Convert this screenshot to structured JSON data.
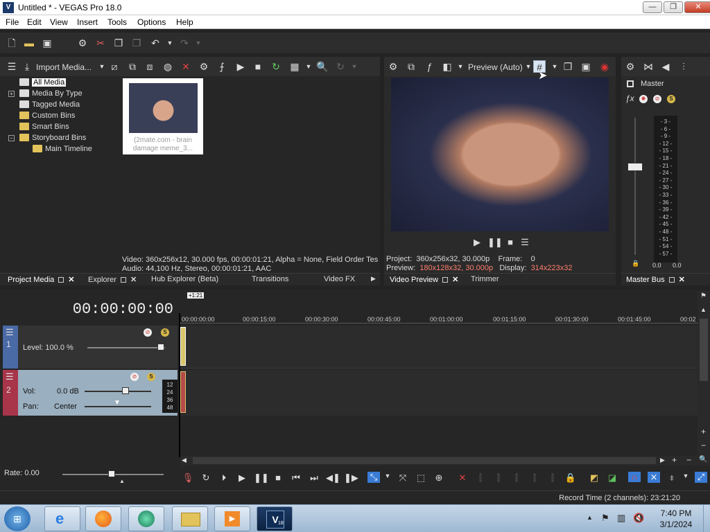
{
  "window": {
    "title": "Untitled * - VEGAS Pro 18.0",
    "app_icon_text": "V",
    "controls": {
      "minimize": "—",
      "maximize": "❐",
      "close": "✕"
    }
  },
  "menu": [
    "File",
    "Edit",
    "View",
    "Insert",
    "Tools",
    "Options",
    "Help"
  ],
  "project_media": {
    "import_label": "Import Media...",
    "tree": [
      {
        "label": "All Media",
        "selected": true
      },
      {
        "label": "Media By Type",
        "expandable": true
      },
      {
        "label": "Tagged Media"
      },
      {
        "label": "Custom Bins"
      },
      {
        "label": "Smart Bins"
      },
      {
        "label": "Storyboard Bins",
        "expandable": true
      },
      {
        "label": "Main Timeline"
      }
    ],
    "thumbnail_caption_line1": "(2mate.com - brain",
    "thumbnail_caption_line2": "damage meme_3...",
    "info_video": "Video: 360x256x12, 30.000 fps, 00:00:01:21, Alpha = None, Field Order Tes",
    "info_audio": "Audio: 44,100 Hz, Stereo, 00:00:01:21, AAC"
  },
  "left_tabs": [
    "Project Media",
    "Explorer",
    "Hub Explorer (Beta)",
    "Transitions",
    "Video FX"
  ],
  "preview": {
    "mode_label": "Preview (Auto)",
    "project_label": "Project:",
    "project_value": "360x256x32, 30.000p",
    "frame_label": "Frame:",
    "frame_value": "0",
    "preview_label": "Preview:",
    "preview_value": "180x128x32, 30.000p",
    "display_label": "Display:",
    "display_value": "314x223x32",
    "accent_color": "#ff7f6e"
  },
  "preview_tabs": [
    "Video Preview",
    "Trimmer"
  ],
  "master": {
    "label": "Master",
    "meter_scale": [
      "3",
      "6",
      "9",
      "12",
      "15",
      "18",
      "21",
      "24",
      "27",
      "30",
      "33",
      "36",
      "39",
      "42",
      "45",
      "48",
      "51",
      "54",
      "57"
    ],
    "left_value": "0.0",
    "right_value": "0.0",
    "tab": "Master Bus"
  },
  "timeline": {
    "timecode": "00:00:00:00",
    "marker_label": "+1:21",
    "ruler": [
      "00:00:00:00",
      "00:00:15:00",
      "00:00:30:00",
      "00:00:45:00",
      "00:01:00:00",
      "00:01:15:00",
      "00:01:30:00",
      "00:01:45:00",
      "00:02"
    ],
    "video_track": {
      "number": "1",
      "level_label": "Level: 100.0 %"
    },
    "audio_track": {
      "number": "2",
      "vol_label": "Vol:",
      "vol_value": "0.0 dB",
      "pan_label": "Pan:",
      "pan_value": "Center",
      "meter_scale": [
        "12",
        "24",
        "36",
        "48"
      ]
    },
    "rate_label": "Rate: 0.00"
  },
  "status": {
    "record_time": "Record Time (2 channels): 23:21:20"
  },
  "taskbar": {
    "time": "7:40 PM",
    "date": "3/1/2024",
    "vegas_badge": "18"
  }
}
